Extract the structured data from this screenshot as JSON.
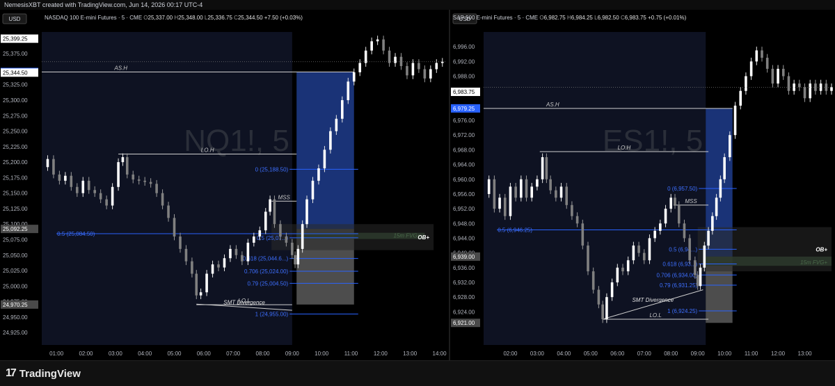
{
  "top_bar": {
    "text": "NemesisXBT created with TradingView.com, Jun 14, 2026 00:17 UTC-4"
  },
  "footer": {
    "brand": "TradingView",
    "logo_mark": "17"
  },
  "chart_data": [
    {
      "type": "candlestick",
      "symbol_watermark": "NQ1!, 5",
      "header": {
        "title": "NASDAQ 100 E-mini Futures · 5 · CME",
        "o_label": "O",
        "o": "25,337.00",
        "h_label": "H",
        "h": "25,348.00",
        "l_label": "L",
        "l": "25,336.75",
        "c_label": "C",
        "c": "25,344.50",
        "change": "+7.50 (+0.03%)"
      },
      "currency": "USD",
      "ylim": [
        24905,
        25410
      ],
      "y_ticks": [
        "25,399.25",
        "25,375.00",
        "25,345.50",
        "25,344.50",
        "25,325.00",
        "25,300.00",
        "25,275.00",
        "25,250.00",
        "25,225.00",
        "25,200.00",
        "25,175.00",
        "25,150.00",
        "25,125.00",
        "25,100.00",
        "25,092.25",
        "25,075.00",
        "25,050.00",
        "25,025.00",
        "25,000.00",
        "24,975.00",
        "24,970.25",
        "24,950.00",
        "24,925.00"
      ],
      "y_tick_values": [
        25399.25,
        25375,
        25345.5,
        25344.5,
        25325,
        25300,
        25275,
        25250,
        25225,
        25200,
        25175,
        25150,
        25125,
        25100,
        25092.25,
        25075,
        25050,
        25025,
        25000,
        24975,
        24970.25,
        24950,
        24925
      ],
      "highlighted_ticks": {
        "25,399.25": "white",
        "25,345.50": "blue",
        "25,344.50": "white",
        "25,092.25": "gray",
        "24,970.25": "gray"
      },
      "x_ticks": [
        "01:00",
        "02:00",
        "03:00",
        "04:00",
        "05:00",
        "06:00",
        "07:00",
        "08:00",
        "09:00",
        "10:00",
        "11:00",
        "12:00",
        "13:00",
        "14:00"
      ],
      "x_range": [
        0.5,
        14.2
      ],
      "shade_range": [
        0.5,
        9.0
      ],
      "closes": [
        [
          0.5,
          25192
        ],
        [
          0.7,
          25205
        ],
        [
          0.9,
          25180
        ],
        [
          1.1,
          25170
        ],
        [
          1.3,
          25178
        ],
        [
          1.5,
          25160
        ],
        [
          1.7,
          25150
        ],
        [
          1.9,
          25170
        ],
        [
          2.1,
          25155
        ],
        [
          2.3,
          25150
        ],
        [
          2.5,
          25140
        ],
        [
          2.7,
          25130
        ],
        [
          2.9,
          25160
        ],
        [
          3.1,
          25200
        ],
        [
          3.25,
          25208
        ],
        [
          3.4,
          25180
        ],
        [
          3.6,
          25172
        ],
        [
          3.8,
          25170
        ],
        [
          4.0,
          25168
        ],
        [
          4.2,
          25165
        ],
        [
          4.4,
          25150
        ],
        [
          4.6,
          25130
        ],
        [
          4.8,
          25110
        ],
        [
          5.0,
          25080
        ],
        [
          5.2,
          25060
        ],
        [
          5.4,
          25040
        ],
        [
          5.6,
          25020
        ],
        [
          5.75,
          24985
        ],
        [
          5.9,
          24990
        ],
        [
          6.1,
          25020
        ],
        [
          6.3,
          25035
        ],
        [
          6.5,
          25030
        ],
        [
          6.7,
          25045
        ],
        [
          6.9,
          25060
        ],
        [
          7.1,
          25050
        ],
        [
          7.3,
          25040
        ],
        [
          7.5,
          25070
        ],
        [
          7.7,
          25080
        ],
        [
          7.9,
          25090
        ],
        [
          8.1,
          25120
        ],
        [
          8.25,
          25140
        ],
        [
          8.4,
          25100
        ],
        [
          8.6,
          25080
        ],
        [
          8.8,
          25070
        ],
        [
          9.0,
          25050
        ],
        [
          9.1,
          25035
        ],
        [
          9.2,
          25060
        ],
        [
          9.35,
          25100
        ],
        [
          9.5,
          25140
        ],
        [
          9.7,
          25170
        ],
        [
          9.9,
          25190
        ],
        [
          10.1,
          25220
        ],
        [
          10.3,
          25250
        ],
        [
          10.5,
          25270
        ],
        [
          10.7,
          25300
        ],
        [
          10.9,
          25330
        ],
        [
          11.1,
          25345
        ],
        [
          11.3,
          25360
        ],
        [
          11.5,
          25380
        ],
        [
          11.7,
          25395
        ],
        [
          11.9,
          25398
        ],
        [
          12.1,
          25380
        ],
        [
          12.3,
          25360
        ],
        [
          12.5,
          25370
        ],
        [
          12.7,
          25355
        ],
        [
          12.9,
          25340
        ],
        [
          13.1,
          25360
        ],
        [
          13.3,
          25350
        ],
        [
          13.5,
          25335
        ],
        [
          13.7,
          25350
        ],
        [
          13.9,
          25360
        ],
        [
          14.1,
          25362
        ]
      ],
      "annotations": [
        {
          "kind": "hline",
          "label": "AS.H",
          "y": 25345.5,
          "color": "#d0d0d0"
        },
        {
          "kind": "segment",
          "label": "LO.H",
          "x": [
            3.1,
            9.15
          ],
          "y": 25213,
          "color": "#d0d0d0"
        },
        {
          "kind": "segment",
          "label": "MSS",
          "x": [
            8.3,
            9.15
          ],
          "y": 25137,
          "color": "#d0d0d0"
        },
        {
          "kind": "segment",
          "label": "LO.L",
          "x": [
            5.75,
            9.0
          ],
          "y": 24970,
          "color": "#d0d0d0"
        },
        {
          "kind": "slanted",
          "label": "SMT Divergence",
          "x": [
            5.75,
            9.0
          ],
          "y": [
            24971,
            24961
          ],
          "color": "#d0d0d0"
        },
        {
          "kind": "fib",
          "label": "0 (25,188.50)",
          "y": 25188.5
        },
        {
          "kind": "fib",
          "label": "0.5 (25,084.50)",
          "y": 25084.5,
          "from": 1.0
        },
        {
          "kind": "fib",
          "label": "0.5 (25,07...)",
          "y": 25078
        },
        {
          "kind": "fib",
          "label": "0.618 (25,044.6...)",
          "y": 25044.6
        },
        {
          "kind": "fib",
          "label": "0.706 (25,024.00)",
          "y": 25024
        },
        {
          "kind": "fib",
          "label": "0.79 (25,004.50)",
          "y": 25004.5
        },
        {
          "kind": "fib",
          "label": "1 (24,955.00)",
          "y": 24955
        }
      ],
      "boxes": [
        {
          "label": "",
          "x": [
            9.15,
            11.1
          ],
          "y": [
            25092.25,
            25345.5
          ],
          "color": "#1f3c8c"
        },
        {
          "label": "",
          "x": [
            9.15,
            11.1
          ],
          "y": [
            24970.25,
            25092.25
          ],
          "color": "#5a5a5a"
        },
        {
          "label": "15m FVG+",
          "x": [
            9.15,
            13.5
          ],
          "y": [
            25076,
            25086
          ],
          "color": "#2f4d2f"
        },
        {
          "label": "OB+",
          "x": [
            8.3,
            13.8
          ],
          "y": [
            25058,
            25100
          ],
          "color": "#2a2a2a"
        }
      ]
    },
    {
      "type": "candlestick",
      "symbol_watermark": "ES1!, 5",
      "header": {
        "title": "S&P 500 E-mini Futures · 5 · CME",
        "o_label": "O",
        "o": "6,982.75",
        "h_label": "H",
        "h": "6,984.25",
        "l_label": "L",
        "l": "6,982.50",
        "c_label": "C",
        "c": "6,983.75",
        "change": "+0.75 (+0.01%)"
      },
      "currency": "USD",
      "ylim": [
        6915,
        7000
      ],
      "y_ticks": [
        "6,996.00",
        "6,992.00",
        "6,988.00",
        "6,983.75",
        "6,979.25",
        "6,976.00",
        "6,972.00",
        "6,968.00",
        "6,964.00",
        "6,960.00",
        "6,956.00",
        "6,952.00",
        "6,948.00",
        "6,944.00",
        "6,940.00",
        "6,939.00",
        "6,936.00",
        "6,932.00",
        "6,928.00",
        "6,924.00",
        "6,921.00"
      ],
      "y_tick_values": [
        6996,
        6992,
        6988,
        6983.75,
        6979.25,
        6976,
        6972,
        6968,
        6964,
        6960,
        6956,
        6952,
        6948,
        6944,
        6940,
        6939,
        6936,
        6932,
        6928,
        6924,
        6921
      ],
      "highlighted_ticks": {
        "6,983.75": "white",
        "6,979.25": "blue",
        "6,939.00": "gray",
        "6,921.00": "gray"
      },
      "x_ticks": [
        "02:00",
        "03:00",
        "04:00",
        "05:00",
        "06:00",
        "07:00",
        "08:00",
        "09:00",
        "10:00",
        "11:00",
        "12:00",
        "13:00"
      ],
      "x_range": [
        1.0,
        14.0
      ],
      "shade_range": [
        1.0,
        9.3
      ],
      "closes": [
        [
          1.0,
          6956
        ],
        [
          1.2,
          6960
        ],
        [
          1.4,
          6952
        ],
        [
          1.6,
          6955
        ],
        [
          1.8,
          6950
        ],
        [
          2.0,
          6958
        ],
        [
          2.2,
          6955
        ],
        [
          2.4,
          6960
        ],
        [
          2.6,
          6955
        ],
        [
          2.8,
          6958
        ],
        [
          3.0,
          6960
        ],
        [
          3.2,
          6966
        ],
        [
          3.35,
          6960
        ],
        [
          3.5,
          6957
        ],
        [
          3.7,
          6955
        ],
        [
          3.9,
          6958
        ],
        [
          4.1,
          6953
        ],
        [
          4.3,
          6950
        ],
        [
          4.5,
          6948
        ],
        [
          4.7,
          6942
        ],
        [
          4.9,
          6935
        ],
        [
          5.1,
          6930
        ],
        [
          5.3,
          6926
        ],
        [
          5.45,
          6922
        ],
        [
          5.6,
          6928
        ],
        [
          5.8,
          6932
        ],
        [
          6.0,
          6936
        ],
        [
          6.2,
          6935
        ],
        [
          6.4,
          6938
        ],
        [
          6.6,
          6942
        ],
        [
          6.8,
          6940
        ],
        [
          7.0,
          6938
        ],
        [
          7.2,
          6944
        ],
        [
          7.4,
          6946
        ],
        [
          7.6,
          6948
        ],
        [
          7.8,
          6952
        ],
        [
          8.0,
          6955
        ],
        [
          8.15,
          6953
        ],
        [
          8.3,
          6948
        ],
        [
          8.5,
          6944
        ],
        [
          8.7,
          6938
        ],
        [
          8.9,
          6934
        ],
        [
          9.0,
          6931
        ],
        [
          9.1,
          6936
        ],
        [
          9.25,
          6942
        ],
        [
          9.4,
          6946
        ],
        [
          9.55,
          6950
        ],
        [
          9.7,
          6955
        ],
        [
          9.85,
          6960
        ],
        [
          10.0,
          6966
        ],
        [
          10.2,
          6972
        ],
        [
          10.4,
          6980
        ],
        [
          10.6,
          6984
        ],
        [
          10.8,
          6988
        ],
        [
          11.0,
          6992
        ],
        [
          11.2,
          6995
        ],
        [
          11.4,
          6993
        ],
        [
          11.6,
          6990
        ],
        [
          11.8,
          6986
        ],
        [
          12.0,
          6990
        ],
        [
          12.2,
          6988
        ],
        [
          12.4,
          6984
        ],
        [
          12.6,
          6986
        ],
        [
          12.8,
          6985
        ],
        [
          13.0,
          6982
        ],
        [
          13.2,
          6986
        ],
        [
          13.4,
          6984
        ],
        [
          13.6,
          6986
        ],
        [
          13.8,
          6984
        ],
        [
          14.0,
          6985
        ]
      ],
      "annotations": [
        {
          "kind": "hline",
          "label": "AS.H",
          "y": 6979.25,
          "color": "#d0d0d0"
        },
        {
          "kind": "segment",
          "label": "LO.H",
          "x": [
            3.1,
            9.4
          ],
          "y": 6967.5,
          "color": "#d0d0d0"
        },
        {
          "kind": "segment",
          "label": "MSS",
          "x": [
            8.1,
            9.4
          ],
          "y": 6953,
          "color": "#d0d0d0"
        },
        {
          "kind": "segment",
          "label": "LO.L",
          "x": [
            5.45,
            9.4
          ],
          "y": 6922,
          "color": "#d0d0d0"
        },
        {
          "kind": "slanted",
          "label": "SMT Divergence",
          "x": [
            5.45,
            9.2
          ],
          "y": [
            6922,
            6930
          ],
          "color": "#d0d0d0"
        },
        {
          "kind": "fib",
          "label": "0 (6,957.50)",
          "y": 6957.5
        },
        {
          "kind": "fib",
          "label": "0.5 (6,946.25)",
          "y": 6946.25,
          "from": 1.5
        },
        {
          "kind": "fib",
          "label": "0.5 (6,94...)",
          "y": 6941
        },
        {
          "kind": "fib",
          "label": "0.618 (6,93...)",
          "y": 6937
        },
        {
          "kind": "fib",
          "label": "0.706 (6,934.00)",
          "y": 6934
        },
        {
          "kind": "fib",
          "label": "0.79 (6,931.25)",
          "y": 6931.25
        },
        {
          "kind": "fib",
          "label": "1 (6,924.25)",
          "y": 6924.25
        }
      ],
      "boxes": [
        {
          "label": "",
          "x": [
            9.3,
            10.3
          ],
          "y": [
            6939,
            6979.25
          ],
          "color": "#1f3c8c"
        },
        {
          "label": "",
          "x": [
            9.3,
            10.3
          ],
          "y": [
            6921,
            6939
          ],
          "color": "#5a5a5a"
        },
        {
          "label": "15m FVG+",
          "x": [
            9.3,
            14.0
          ],
          "y": [
            6936.5,
            6939
          ],
          "color": "#2f4d2f"
        },
        {
          "label": "OB+",
          "x": [
            9.0,
            14.0
          ],
          "y": [
            6935,
            6947
          ],
          "color": "#2a2a2a"
        }
      ]
    }
  ]
}
